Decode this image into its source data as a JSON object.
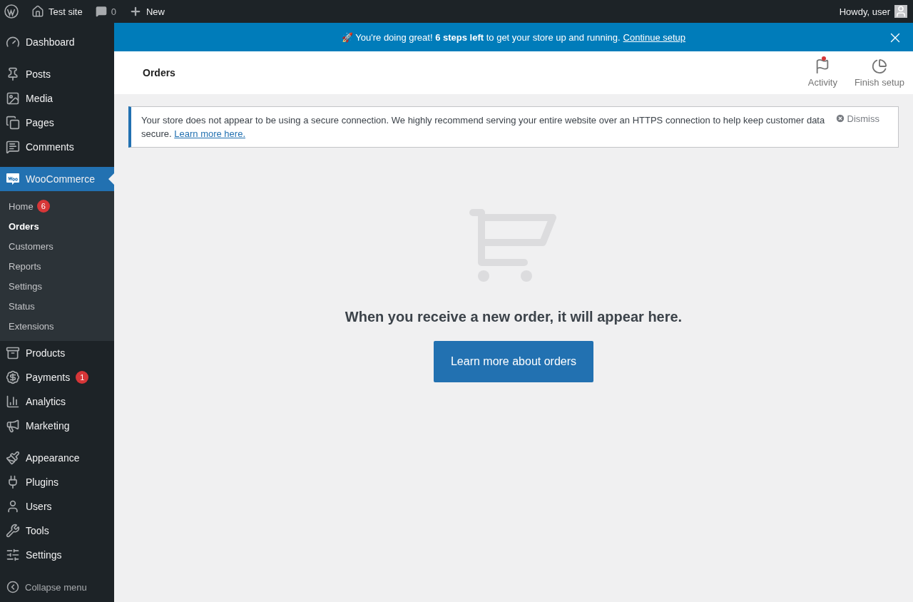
{
  "admin_bar": {
    "site": "Test site",
    "comments": "0",
    "new": "New",
    "greeting": "Howdy, user"
  },
  "sidebar": {
    "groups": [
      [
        {
          "label": "Dashboard",
          "selected": false
        }
      ],
      [
        {
          "label": "Posts",
          "selected": false
        },
        {
          "label": "Media",
          "selected": false
        },
        {
          "label": "Pages",
          "selected": false
        },
        {
          "label": "Comments",
          "selected": false
        }
      ],
      [
        {
          "label": "WooCommerce",
          "selected": true,
          "children": [
            {
              "label": "Home",
              "badge": "6",
              "selected": false
            },
            {
              "label": "Orders",
              "selected": true
            },
            {
              "label": "Customers",
              "selected": false
            },
            {
              "label": "Reports",
              "selected": false
            },
            {
              "label": "Settings",
              "selected": false
            },
            {
              "label": "Status",
              "selected": false
            },
            {
              "label": "Extensions",
              "selected": false
            }
          ]
        },
        {
          "label": "Products",
          "selected": false
        },
        {
          "label": "Payments",
          "badge": "1",
          "selected": false
        },
        {
          "label": "Analytics",
          "selected": false
        },
        {
          "label": "Marketing",
          "selected": false
        }
      ],
      [
        {
          "label": "Appearance",
          "selected": false
        },
        {
          "label": "Plugins",
          "selected": false
        },
        {
          "label": "Users",
          "selected": false
        },
        {
          "label": "Tools",
          "selected": false
        },
        {
          "label": "Settings",
          "selected": false
        }
      ]
    ],
    "collapse": "Collapse menu"
  },
  "setup_banner": {
    "message": "🚀 You're doing great! **6 steps left** to get your store up and running.",
    "link": "Continue setup"
  },
  "header": {
    "title": "Orders",
    "actions": [
      {
        "label": "Activity",
        "alert": true
      },
      {
        "label": "Finish setup",
        "alert": false
      }
    ]
  },
  "notice": {
    "text": "Your store does not appear to be using a secure connection. We highly recommend serving your entire website over an HTTPS connection to help keep customer data secure.",
    "link": "Learn more here.",
    "dismiss": "Dismiss"
  },
  "empty_state": {
    "message": "When you receive a new order, it will appear here.",
    "button": "Learn more about orders"
  }
}
